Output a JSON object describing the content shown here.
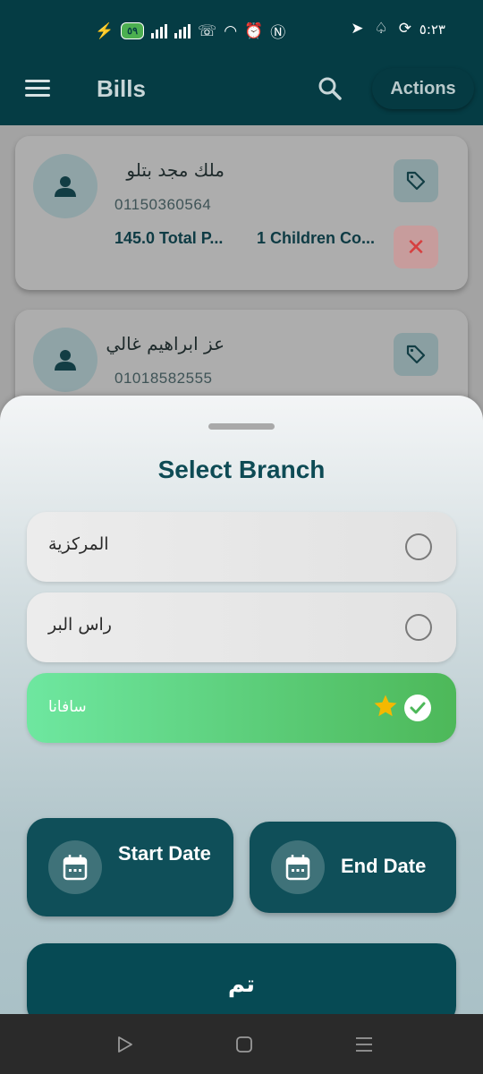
{
  "status_bar": {
    "time": "٥:٢٣",
    "battery": "٥٩"
  },
  "app_bar": {
    "title": "Bills",
    "actions_label": "Actions"
  },
  "cards": [
    {
      "name": "ملك مجد بتلو",
      "phone": "01150360564",
      "total": "145.0 Total P...",
      "children": "1 Children Co..."
    },
    {
      "name": "عز ابراهيم غالي",
      "phone": "01018582555"
    }
  ],
  "sheet": {
    "title": "Select Branch",
    "options": [
      {
        "label": "المركزية",
        "selected": false
      },
      {
        "label": "راس البر",
        "selected": false
      },
      {
        "label": "سافانا",
        "selected": true
      }
    ],
    "start_date_label": "Start Date",
    "end_date_label": "End Date",
    "done_label": "تم"
  },
  "colors": {
    "primary": "#053c44",
    "selected_gradient_start": "#6ee7a0",
    "selected_gradient_end": "#4db859",
    "star": "#f5b800"
  }
}
